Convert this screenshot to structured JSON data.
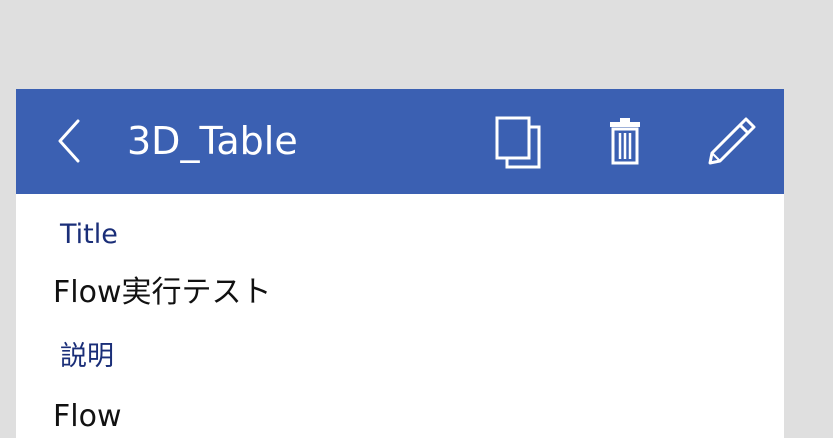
{
  "header": {
    "title": "3D_Table",
    "back_icon": "chevron-left-icon",
    "copy_icon": "copy-icon",
    "delete_icon": "trash-icon",
    "edit_icon": "pencil-icon",
    "background": "#3b60b2"
  },
  "fields": [
    {
      "label": "Title",
      "value": "Flow実行テスト"
    },
    {
      "label": "説明",
      "value": "Flow"
    }
  ]
}
